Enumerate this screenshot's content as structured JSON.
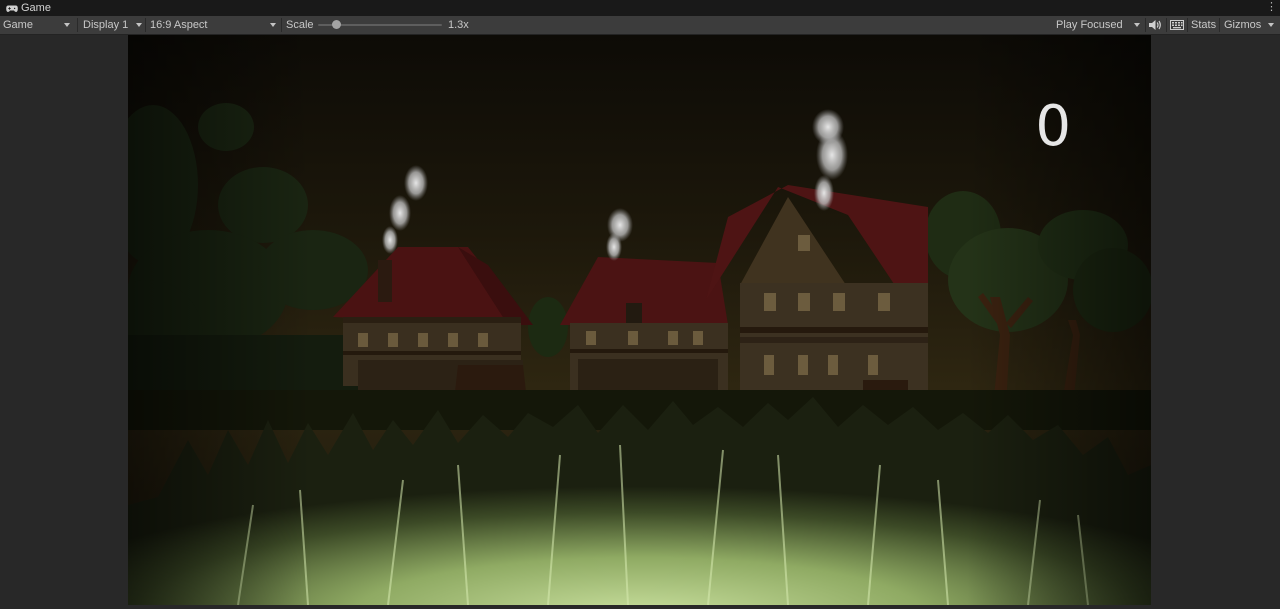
{
  "window": {
    "tab_title": "Game",
    "tab_icon": "gamepad-icon",
    "menu_icon": "kebab-menu-icon"
  },
  "toolbar": {
    "view_mode": "Game",
    "display": "Display 1",
    "aspect": "16:9 Aspect",
    "scale_label": "Scale",
    "scale_value": "1.3x",
    "scale_level": 1.3,
    "play_mode": "Play Focused",
    "audio_icon": "speaker-icon",
    "stats_grid_icon": "keyboard-grid-icon",
    "stats": "Stats",
    "gizmos": "Gizmos"
  },
  "game": {
    "score": "0",
    "sky_color": "#201a0b",
    "grass_color": "#a6c57c"
  }
}
